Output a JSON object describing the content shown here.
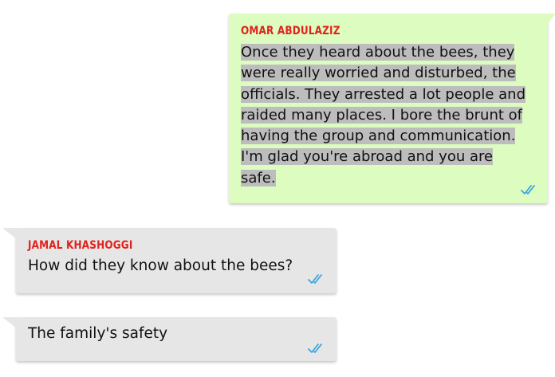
{
  "messages": [
    {
      "sender": "OMAR ABDULAZIZ",
      "lines": [
        "Once they heard about the bees, they",
        "were really worried and disturbed, the",
        "officials. They arrested a lot people and",
        "raided many places. I bore the brunt of",
        "having the group and communication.",
        "I'm glad you're abroad and you are",
        "safe."
      ],
      "status": "read-receipt-double-check-icon"
    },
    {
      "sender": "JAMAL KHASHOGGI",
      "text": "How did they know about the bees?",
      "status": "read-receipt-double-check-icon"
    },
    {
      "text": "The family's safety",
      "status": "read-receipt-double-check-icon"
    }
  ],
  "colors": {
    "sent_bubble": "#dcfcc0",
    "received_bubble": "#e6e6e6",
    "sender_name": "#e0221c",
    "read_ticks": "#3aa6e0",
    "selection_highlight": "#bdbdbd"
  }
}
